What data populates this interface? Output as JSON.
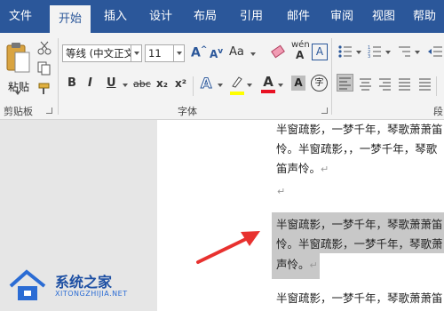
{
  "tabs": [
    {
      "label": "文件"
    },
    {
      "label": "开始"
    },
    {
      "label": "插入"
    },
    {
      "label": "设计"
    },
    {
      "label": "布局"
    },
    {
      "label": "引用"
    },
    {
      "label": "邮件"
    },
    {
      "label": "审阅"
    },
    {
      "label": "视图"
    },
    {
      "label": "帮助"
    }
  ],
  "active_tab": "开始",
  "clipboard": {
    "paste_label": "粘贴",
    "group_label": "剪贴板"
  },
  "font": {
    "font_name": "等线 (中文正文",
    "font_size": "11",
    "group_label": "字体",
    "bold": "B",
    "italic": "I",
    "underline": "U",
    "strikethrough": "abc",
    "subscript": "x₂",
    "superscript": "x²",
    "phonetic_guide": "wén",
    "char_border": "A",
    "char_shading": "A",
    "enclose": "字",
    "grow": "A",
    "shrink": "A",
    "change_case": "Aa"
  },
  "paragraph": {
    "group_label_partial": "段"
  },
  "document": {
    "lines_para1": [
      "半窗疏影，一梦千年，琴歌萧萧笛",
      "怜。半窗疏影，，一梦千年，琴歌",
      "笛声怜。"
    ],
    "highlighted_lines": [
      "半窗疏影，一梦千年，琴歌萧萧笛",
      "怜。半窗疏影，一梦千年，琴歌萧",
      "声怜。"
    ],
    "lines_para3": [
      "半窗疏影，一梦千年，琴歌萧萧笛"
    ],
    "paragraph_mark": "↵"
  },
  "watermark": {
    "name": "系统之家",
    "url": "XITONGZHIJIA.NET"
  },
  "colors": {
    "accent": "#2b579a",
    "highlight": "#c8c8c8",
    "arrow": "#e8312f",
    "font_color": "#e81123",
    "highlight_yellow": "#ffff00"
  }
}
